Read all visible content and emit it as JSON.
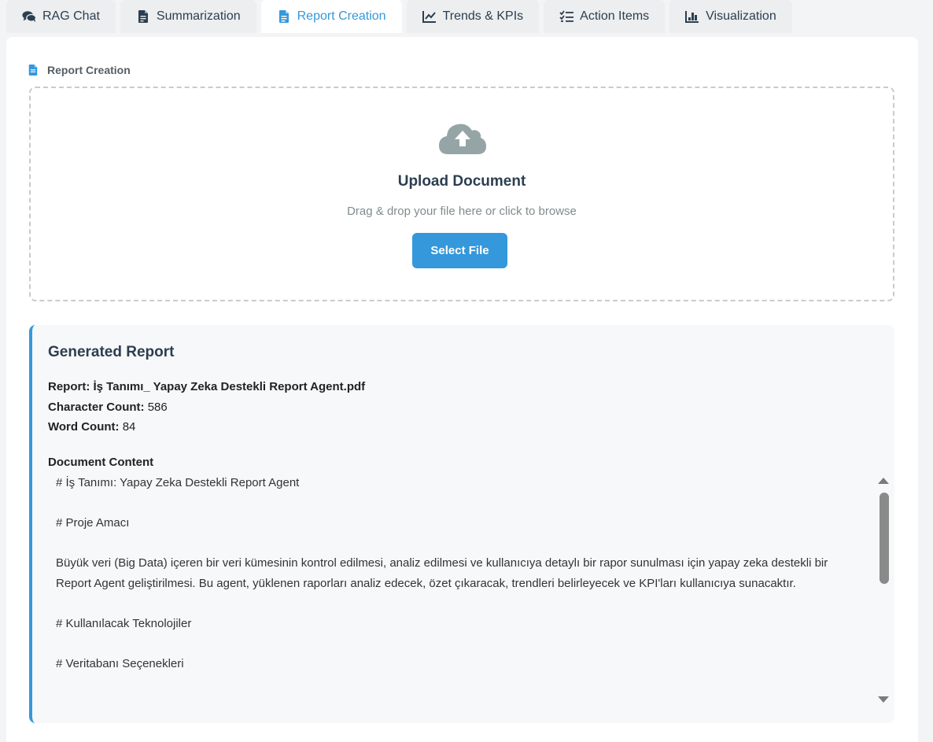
{
  "tabs": [
    {
      "label": "RAG Chat",
      "icon": "comments-icon",
      "active": false
    },
    {
      "label": "Summarization",
      "icon": "file-alt-icon",
      "active": false
    },
    {
      "label": "Report Creation",
      "icon": "file-icon",
      "active": true
    },
    {
      "label": "Trends & KPIs",
      "icon": "line-chart-icon",
      "active": false
    },
    {
      "label": "Action Items",
      "icon": "tasks-icon",
      "active": false
    },
    {
      "label": "Visualization",
      "icon": "bar-chart-icon",
      "active": false
    }
  ],
  "section": {
    "title": "Report Creation",
    "icon": "file-icon"
  },
  "upload": {
    "icon": "cloud-upload-icon",
    "title": "Upload Document",
    "subtitle": "Drag & drop your file here or click to browse",
    "button_label": "Select File"
  },
  "report": {
    "heading": "Generated Report",
    "report_label": "Report:",
    "report_value": "İş Tanımı_ Yapay Zeka Destekli Report Agent.pdf",
    "char_label": "Character Count:",
    "char_value": "586",
    "word_label": "Word Count:",
    "word_value": "84",
    "content_label": "Document Content",
    "content_lines": [
      "# İş Tanımı: Yapay Zeka Destekli Report Agent",
      "# Proje Amacı",
      "Büyük veri (Big Data) içeren bir veri kümesinin kontrol edilmesi, analiz edilmesi ve kullanıcıya detaylı bir rapor sunulması için yapay zeka destekli bir Report Agent geliştirilmesi. Bu agent, yüklenen raporları analiz edecek, özet çıkaracak, trendleri belirleyecek ve KPI'ları kullanıcıya sunacaktır.",
      "# Kullanılacak Teknolojiler",
      "# Veritabanı Seçenekleri"
    ]
  },
  "colors": {
    "accent": "#3498db",
    "text_dark": "#2c3e50",
    "muted": "#7f8c8d"
  }
}
